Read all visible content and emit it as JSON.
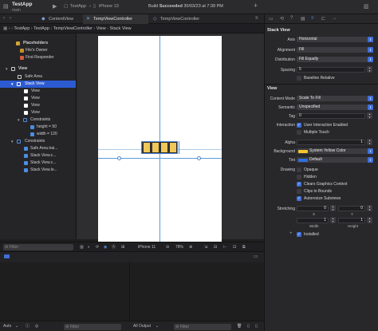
{
  "window": {
    "project_name": "TestApp",
    "branch": "main",
    "run_destination": "iPhone 13",
    "status_prefix": "Build",
    "status_word": "Succeeded",
    "status_date": "30/03/23 at 7:39 PM"
  },
  "tabs": [
    {
      "label": "ContentView"
    },
    {
      "label": "TempViewController"
    },
    {
      "label": "TempViewController"
    }
  ],
  "jumpbar": {
    "items": [
      "TestApp",
      "TestApp",
      "TempViewController",
      "View",
      "Stack View"
    ]
  },
  "outline": {
    "placeholders": "Placeholders",
    "files_owner": "File's Owner",
    "first_responder": "First Responder",
    "view": "View",
    "safe_area": "Safe Area",
    "stack_view": "Stack View",
    "stack_children": [
      "View",
      "View",
      "View",
      "View"
    ],
    "constraints": "Constraints",
    "inner_constraints": [
      "height = 50",
      "width = 120"
    ],
    "outer_constraints": [
      "Safe Area.trai...",
      "Stack View.c...",
      "Stack View.c...",
      "Stack View.le..."
    ],
    "filter_placeholder": "Filter"
  },
  "canvas": {
    "device": "iPhone 11",
    "zoom": "78%"
  },
  "debug": {
    "auto_label": "Auto",
    "filter_placeholder": "Filter",
    "output_label": "All Output",
    "filter_placeholder_2": "Filter"
  },
  "inspector": {
    "stack_view": {
      "title": "Stack View",
      "axis_label": "Axis",
      "axis_value": "Horizontal",
      "alignment_label": "Alignment",
      "alignment_value": "Fill",
      "distribution_label": "Distribution",
      "distribution_value": "Fill Equally",
      "spacing_label": "Spacing",
      "spacing_value": "5",
      "baseline_relative": "Baseline Relative"
    },
    "view": {
      "title": "View",
      "content_mode_label": "Content Mode",
      "content_mode_value": "Scale To Fill",
      "semantic_label": "Semantic",
      "semantic_value": "Unspecified",
      "tag_label": "Tag",
      "tag_value": "0",
      "interaction_label": "Interaction",
      "user_interaction": "User Interaction Enabled",
      "multiple_touch": "Multiple Touch",
      "alpha_label": "Alpha",
      "alpha_value": "1",
      "background_label": "Background",
      "background_value": "System Yellow Color",
      "background_swatch": "#f7c52d",
      "tint_label": "Tint",
      "tint_value": "Default",
      "tint_swatch": "#2f6fe0",
      "drawing_label": "Drawing",
      "opaque": "Opaque",
      "hidden": "Hidden",
      "clears_graphics": "Clears Graphics Context",
      "clips_bounds": "Clips to Bounds",
      "autoresize": "Autoresize Subviews",
      "stretching_label": "Stretching",
      "stretch_x": "0",
      "stretch_y": "0",
      "x_label": "X",
      "y_label": "Y",
      "stretch_w": "1",
      "stretch_h": "1",
      "width_label": "Width",
      "height_label": "Height",
      "installed": "Installed"
    }
  },
  "colors": {
    "accent": "#2c5bd1",
    "stack_fill": "#f0c75a",
    "guide": "#5b9bd5"
  }
}
